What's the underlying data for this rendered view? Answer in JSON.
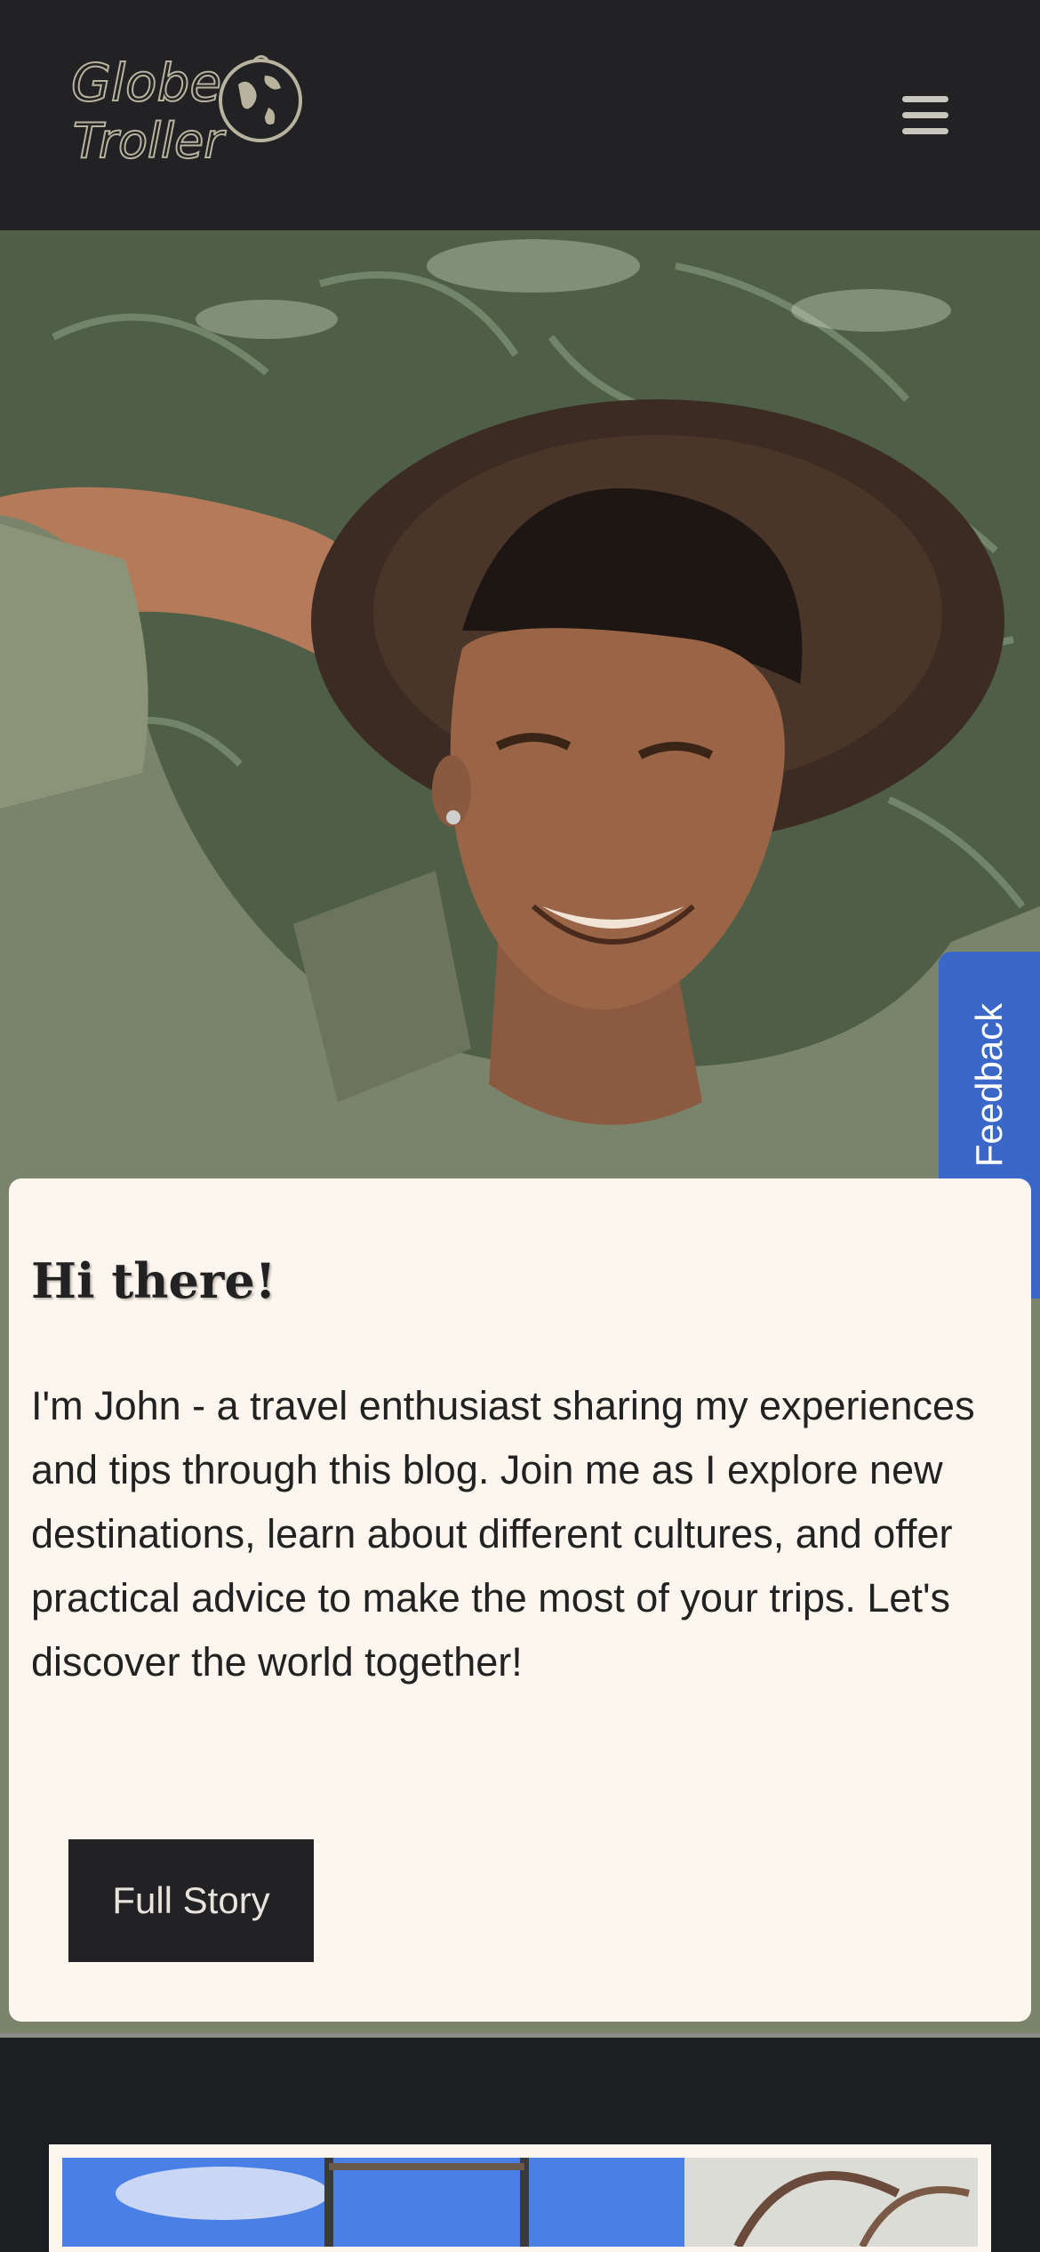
{
  "header": {
    "logo_text_line1": "Globe",
    "logo_text_line2": "Troller",
    "logo_icon": "globe-icon",
    "menu_icon": "hamburger-menu-icon",
    "background_color": "#222224"
  },
  "feedback": {
    "label": "Feedback",
    "icon": "smiley-icon",
    "color": "#3b67c9"
  },
  "intro": {
    "title": "Hi there!",
    "body": "I'm John - a travel enthusiast sharing my experiences and tips through this blog. Join me as I explore new destinations, learn about different cultures, and offer practical advice to make the most of your trips. Let's discover the world together!",
    "button_label": "Full Story",
    "card_color": "#fdf6ee"
  },
  "hero": {
    "image": "portrait-photo"
  },
  "next_post": {
    "image": "bus-window-photo"
  }
}
